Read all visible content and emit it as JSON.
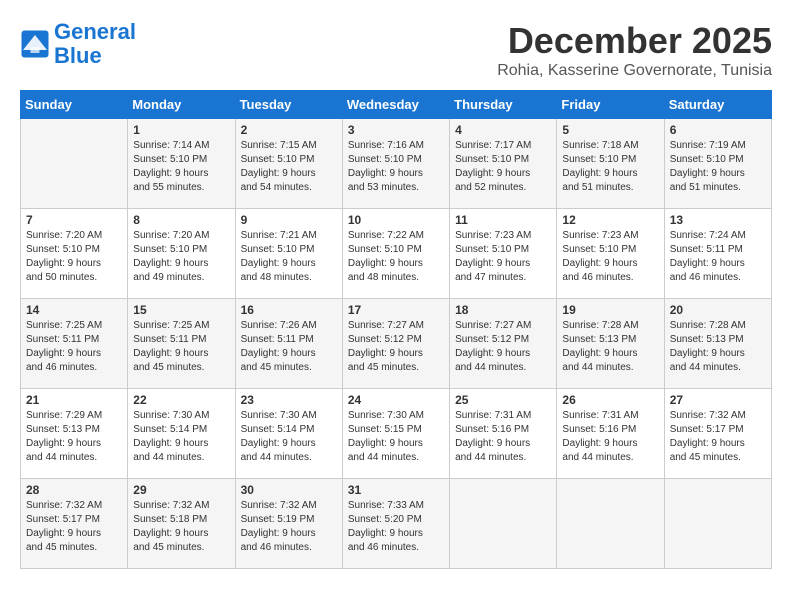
{
  "logo": {
    "line1": "General",
    "line2": "Blue"
  },
  "title": "December 2025",
  "location": "Rohia, Kasserine Governorate, Tunisia",
  "days_of_week": [
    "Sunday",
    "Monday",
    "Tuesday",
    "Wednesday",
    "Thursday",
    "Friday",
    "Saturday"
  ],
  "weeks": [
    [
      {
        "day": "",
        "info": ""
      },
      {
        "day": "1",
        "info": "Sunrise: 7:14 AM\nSunset: 5:10 PM\nDaylight: 9 hours\nand 55 minutes."
      },
      {
        "day": "2",
        "info": "Sunrise: 7:15 AM\nSunset: 5:10 PM\nDaylight: 9 hours\nand 54 minutes."
      },
      {
        "day": "3",
        "info": "Sunrise: 7:16 AM\nSunset: 5:10 PM\nDaylight: 9 hours\nand 53 minutes."
      },
      {
        "day": "4",
        "info": "Sunrise: 7:17 AM\nSunset: 5:10 PM\nDaylight: 9 hours\nand 52 minutes."
      },
      {
        "day": "5",
        "info": "Sunrise: 7:18 AM\nSunset: 5:10 PM\nDaylight: 9 hours\nand 51 minutes."
      },
      {
        "day": "6",
        "info": "Sunrise: 7:19 AM\nSunset: 5:10 PM\nDaylight: 9 hours\nand 51 minutes."
      }
    ],
    [
      {
        "day": "7",
        "info": "Sunrise: 7:20 AM\nSunset: 5:10 PM\nDaylight: 9 hours\nand 50 minutes."
      },
      {
        "day": "8",
        "info": "Sunrise: 7:20 AM\nSunset: 5:10 PM\nDaylight: 9 hours\nand 49 minutes."
      },
      {
        "day": "9",
        "info": "Sunrise: 7:21 AM\nSunset: 5:10 PM\nDaylight: 9 hours\nand 48 minutes."
      },
      {
        "day": "10",
        "info": "Sunrise: 7:22 AM\nSunset: 5:10 PM\nDaylight: 9 hours\nand 48 minutes."
      },
      {
        "day": "11",
        "info": "Sunrise: 7:23 AM\nSunset: 5:10 PM\nDaylight: 9 hours\nand 47 minutes."
      },
      {
        "day": "12",
        "info": "Sunrise: 7:23 AM\nSunset: 5:10 PM\nDaylight: 9 hours\nand 46 minutes."
      },
      {
        "day": "13",
        "info": "Sunrise: 7:24 AM\nSunset: 5:11 PM\nDaylight: 9 hours\nand 46 minutes."
      }
    ],
    [
      {
        "day": "14",
        "info": "Sunrise: 7:25 AM\nSunset: 5:11 PM\nDaylight: 9 hours\nand 46 minutes."
      },
      {
        "day": "15",
        "info": "Sunrise: 7:25 AM\nSunset: 5:11 PM\nDaylight: 9 hours\nand 45 minutes."
      },
      {
        "day": "16",
        "info": "Sunrise: 7:26 AM\nSunset: 5:11 PM\nDaylight: 9 hours\nand 45 minutes."
      },
      {
        "day": "17",
        "info": "Sunrise: 7:27 AM\nSunset: 5:12 PM\nDaylight: 9 hours\nand 45 minutes."
      },
      {
        "day": "18",
        "info": "Sunrise: 7:27 AM\nSunset: 5:12 PM\nDaylight: 9 hours\nand 44 minutes."
      },
      {
        "day": "19",
        "info": "Sunrise: 7:28 AM\nSunset: 5:13 PM\nDaylight: 9 hours\nand 44 minutes."
      },
      {
        "day": "20",
        "info": "Sunrise: 7:28 AM\nSunset: 5:13 PM\nDaylight: 9 hours\nand 44 minutes."
      }
    ],
    [
      {
        "day": "21",
        "info": "Sunrise: 7:29 AM\nSunset: 5:13 PM\nDaylight: 9 hours\nand 44 minutes."
      },
      {
        "day": "22",
        "info": "Sunrise: 7:30 AM\nSunset: 5:14 PM\nDaylight: 9 hours\nand 44 minutes."
      },
      {
        "day": "23",
        "info": "Sunrise: 7:30 AM\nSunset: 5:14 PM\nDaylight: 9 hours\nand 44 minutes."
      },
      {
        "day": "24",
        "info": "Sunrise: 7:30 AM\nSunset: 5:15 PM\nDaylight: 9 hours\nand 44 minutes."
      },
      {
        "day": "25",
        "info": "Sunrise: 7:31 AM\nSunset: 5:16 PM\nDaylight: 9 hours\nand 44 minutes."
      },
      {
        "day": "26",
        "info": "Sunrise: 7:31 AM\nSunset: 5:16 PM\nDaylight: 9 hours\nand 44 minutes."
      },
      {
        "day": "27",
        "info": "Sunrise: 7:32 AM\nSunset: 5:17 PM\nDaylight: 9 hours\nand 45 minutes."
      }
    ],
    [
      {
        "day": "28",
        "info": "Sunrise: 7:32 AM\nSunset: 5:17 PM\nDaylight: 9 hours\nand 45 minutes."
      },
      {
        "day": "29",
        "info": "Sunrise: 7:32 AM\nSunset: 5:18 PM\nDaylight: 9 hours\nand 45 minutes."
      },
      {
        "day": "30",
        "info": "Sunrise: 7:32 AM\nSunset: 5:19 PM\nDaylight: 9 hours\nand 46 minutes."
      },
      {
        "day": "31",
        "info": "Sunrise: 7:33 AM\nSunset: 5:20 PM\nDaylight: 9 hours\nand 46 minutes."
      },
      {
        "day": "",
        "info": ""
      },
      {
        "day": "",
        "info": ""
      },
      {
        "day": "",
        "info": ""
      }
    ]
  ]
}
